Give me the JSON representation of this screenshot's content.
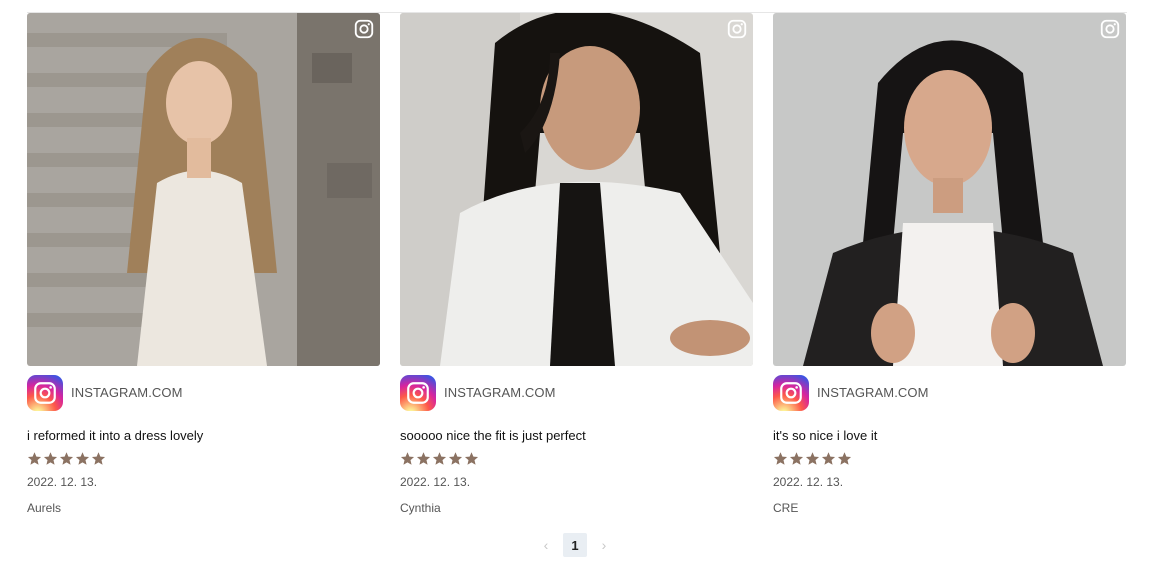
{
  "colors": {
    "star": "#8b7262",
    "pagination_active_bg": "#e9eef3",
    "muted_text": "#555555"
  },
  "cards": [
    {
      "source": "INSTAGRAM.COM",
      "caption": "i reformed it into a dress lovely",
      "rating": 5,
      "date": "2022. 12. 13.",
      "author": "Aurels",
      "photo": "woman-long-hair-white-dress"
    },
    {
      "source": "INSTAGRAM.COM",
      "caption": "sooooo nice the fit is just perfect",
      "rating": 5,
      "date": "2022. 12. 13.",
      "author": "Cynthia",
      "photo": "woman-bob-white-jacket"
    },
    {
      "source": "INSTAGRAM.COM",
      "caption": "it's so nice i love it",
      "rating": 5,
      "date": "2022. 12. 13.",
      "author": "CRE",
      "photo": "woman-bob-leather-jacket"
    }
  ],
  "pagination": {
    "prev": "‹",
    "current": "1",
    "next": "›"
  }
}
